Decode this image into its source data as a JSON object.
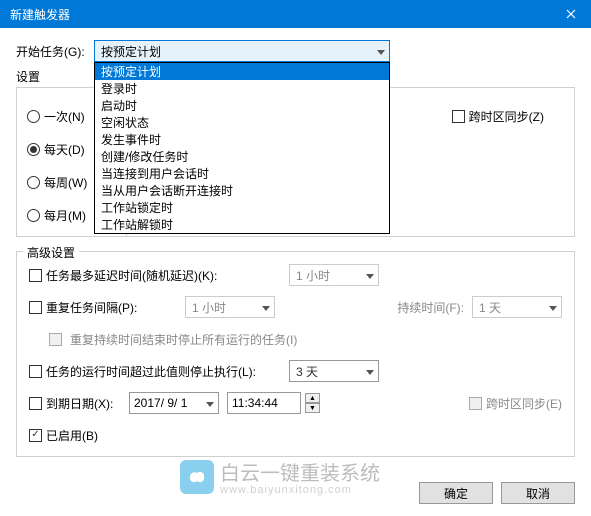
{
  "title": "新建触发器",
  "begin_task_label": "开始任务(G):",
  "combo_selected": "按预定计划",
  "dropdown_options": [
    "按预定计划",
    "登录时",
    "启动时",
    "空闲状态",
    "发生事件时",
    "创建/修改任务时",
    "当连接到用户会话时",
    "当从用户会话断开连接时",
    "工作站锁定时",
    "工作站解锁时"
  ],
  "settings_label": "设置",
  "radios": {
    "once": "一次(N)",
    "daily": "每天(D)",
    "weekly": "每周(W)",
    "monthly": "每月(M)"
  },
  "sync_tz": "跨时区同步(Z)",
  "advanced": {
    "legend": "高级设置",
    "delay": "任务最多延迟时间(随机延迟)(K):",
    "delay_val": "1 小时",
    "repeat": "重复任务间隔(P):",
    "repeat_val": "1 小时",
    "duration_label": "持续时间(F):",
    "duration_val": "1 天",
    "stop_all": "重复持续时间结束时停止所有运行的任务(I)",
    "stop_after": "任务的运行时间超过此值则停止执行(L):",
    "stop_after_val": "3 天",
    "expire": "到期日期(X):",
    "expire_date": "2017/ 9/ 1",
    "expire_time": "11:34:44",
    "sync_tz2": "跨时区同步(E)",
    "enabled": "已启用(B)"
  },
  "buttons": {
    "ok": "确定",
    "cancel": "取消"
  },
  "watermark": {
    "line1": "白云一键重装系统",
    "line2": "www.baiyunxitong.com"
  }
}
